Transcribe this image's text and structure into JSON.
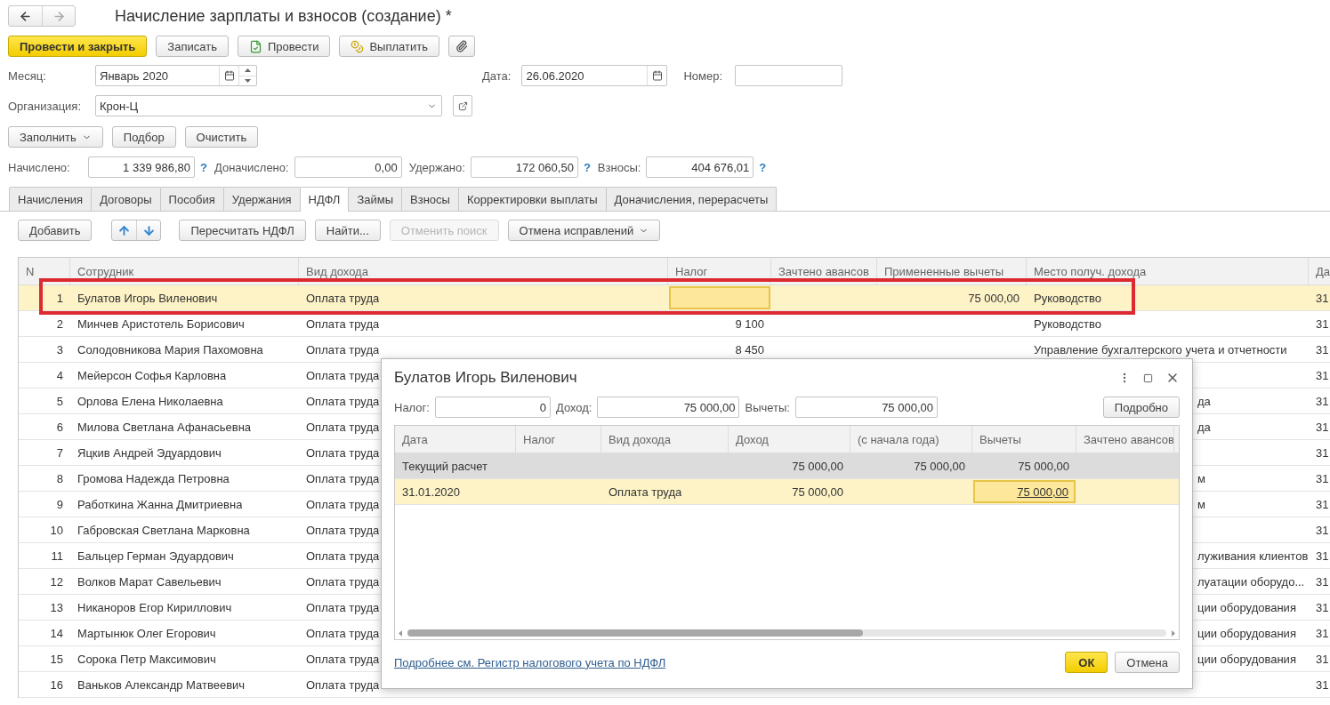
{
  "title": "Начисление зарплаты и взносов (создание) *",
  "toolbar": [
    {
      "label": "Провести и закрыть",
      "kind": "primary"
    },
    {
      "label": "Записать",
      "kind": "plain"
    },
    {
      "label": "Провести",
      "kind": "post"
    },
    {
      "label": "Выплатить",
      "kind": "pay"
    },
    {
      "kind": "attach"
    }
  ],
  "month": {
    "label": "Месяц:",
    "value": "Январь 2020"
  },
  "date": {
    "label": "Дата:",
    "value": "26.06.2020"
  },
  "number": {
    "label": "Номер:"
  },
  "organization": {
    "label": "Организация:",
    "value": "Крон-Ц"
  },
  "fill_buttons": [
    {
      "label": "Заполнить",
      "dropdown": true
    },
    {
      "label": "Подбор",
      "dropdown": false
    },
    {
      "label": "Очистить",
      "dropdown": false
    }
  ],
  "totals": [
    {
      "label": "Начислено:",
      "value": "1 339 986,80",
      "help": "?"
    },
    {
      "label": "Доначислено:",
      "value": "0,00"
    },
    {
      "label": "Удержано:",
      "value": "172 060,50",
      "help": "?"
    },
    {
      "label": "Взносы:",
      "value": "404 676,01",
      "help": "?"
    }
  ],
  "tabs": [
    {
      "label": "Начисления",
      "selected": false
    },
    {
      "label": "Договоры",
      "selected": false
    },
    {
      "label": "Пособия",
      "selected": false
    },
    {
      "label": "Удержания",
      "selected": false
    },
    {
      "label": "НДФЛ",
      "selected": true
    },
    {
      "label": "Займы",
      "selected": false
    },
    {
      "label": "Взносы",
      "selected": false
    },
    {
      "label": "Корректировки выплаты",
      "selected": false
    },
    {
      "label": "Доначисления, перерасчеты",
      "selected": false
    }
  ],
  "table_toolbar": [
    {
      "kind": "button",
      "label": "Добавить",
      "disabled": false
    },
    {
      "kind": "arrows"
    },
    {
      "kind": "button",
      "label": "Пересчитать НДФЛ",
      "disabled": false
    },
    {
      "kind": "button",
      "label": "Найти...",
      "disabled": false
    },
    {
      "kind": "button",
      "label": "Отменить поиск",
      "disabled": true
    },
    {
      "kind": "menu",
      "label": "Отмена исправлений",
      "disabled": false
    }
  ],
  "table": {
    "columns": [
      "N",
      "Сотрудник",
      "Вид дохода",
      "Налог",
      "Зачтено авансов",
      "Примененные вычеты",
      "Место получ. дохода",
      "Да"
    ],
    "rows": [
      {
        "n": "1",
        "employee": "Булатов Игорь Виленович",
        "income": "Оплата труда",
        "tax": "",
        "deductions": "75 000,00",
        "place": "Руководство",
        "date": "31",
        "selected": true,
        "covered": false
      },
      {
        "n": "2",
        "employee": "Минчев Аристотель Борисович",
        "income": "Оплата труда",
        "tax": "9 100",
        "place": "Руководство",
        "date": "31",
        "selected": false,
        "covered": false
      },
      {
        "n": "3",
        "employee": "Солодовникова Мария Пахомовна",
        "income": "Оплата труда",
        "tax": "8 450",
        "place": "Управление бухгалтерского учета и отчетности",
        "date": "31",
        "selected": false,
        "covered": false
      },
      {
        "n": "4",
        "employee": "Мейерсон Софья Карловна",
        "income": "Оплата труда",
        "date": "31",
        "selected": false
      },
      {
        "n": "5",
        "employee": "Орлова Елена Николаевна",
        "income": "Оплата труда",
        "place": "да",
        "date": "31",
        "selected": false,
        "covered": true
      },
      {
        "n": "6",
        "employee": "Милова Светлана Афанасьевна",
        "income": "Оплата труда",
        "place": "да",
        "date": "31",
        "selected": false,
        "covered": true
      },
      {
        "n": "7",
        "employee": "Яцкив Андрей Эдуардович",
        "income": "Оплата труда",
        "date": "31",
        "selected": false
      },
      {
        "n": "8",
        "employee": "Громова Надежда Петровна",
        "income": "Оплата труда",
        "place": "м",
        "date": "31",
        "selected": false,
        "covered": true
      },
      {
        "n": "9",
        "employee": "Работкина Жанна Дмитриевна",
        "income": "Оплата труда",
        "place": "м",
        "date": "31",
        "selected": false,
        "covered": true
      },
      {
        "n": "10",
        "employee": "Габровская Светлана Марковна",
        "income": "Оплата труда",
        "date": "31",
        "selected": false
      },
      {
        "n": "11",
        "employee": "Бальцер Герман Эдуардович",
        "income": "Оплата труда",
        "place": "луживания клиентов",
        "date": "31",
        "selected": false,
        "covered": true
      },
      {
        "n": "12",
        "employee": "Волков Марат Савельевич",
        "income": "Оплата труда",
        "place": "луатации оборудо...",
        "date": "31",
        "selected": false,
        "covered": true
      },
      {
        "n": "13",
        "employee": "Никаноров Егор Кириллович",
        "income": "Оплата труда",
        "place": "ции оборудования",
        "date": "31",
        "selected": false,
        "covered": true
      },
      {
        "n": "14",
        "employee": "Мартынюк Олег Егорович",
        "income": "Оплата труда",
        "place": "ции оборудования",
        "date": "31",
        "selected": false,
        "covered": true
      },
      {
        "n": "15",
        "employee": "Сорока Петр Максимович",
        "income": "Оплата труда",
        "place": "ции оборудования",
        "date": "31",
        "selected": false,
        "covered": true
      },
      {
        "n": "16",
        "employee": "Ваньков Александр Матвеевич",
        "income": "Оплата труда",
        "date": "31",
        "selected": false
      }
    ]
  },
  "dialog": {
    "title": "Булатов Игорь Виленович",
    "fields": [
      {
        "label": "Налог:",
        "value": "0"
      },
      {
        "label": "Доход:",
        "value": "75 000,00"
      },
      {
        "label": "Вычеты:",
        "value": "75 000,00"
      }
    ],
    "details_button": "Подробно",
    "columns": [
      "Дата",
      "Налог",
      "Вид дохода",
      "Доход",
      "(с начала года)",
      "Вычеты",
      "Зачтено авансов"
    ],
    "rows": [
      {
        "kind": "total",
        "date": "Текущий расчет",
        "income_amount": "75 000,00",
        "year_total": "75 000,00",
        "deductions": "75 000,00"
      },
      {
        "kind": "entry",
        "date": "31.01.2020",
        "income": "Оплата труда",
        "income_amount": "75 000,00",
        "deductions": "75 000,00"
      }
    ],
    "link": "Подробнее см. Регистр налогового учета по НДФЛ",
    "ok": "ОК",
    "cancel": "Отмена"
  }
}
